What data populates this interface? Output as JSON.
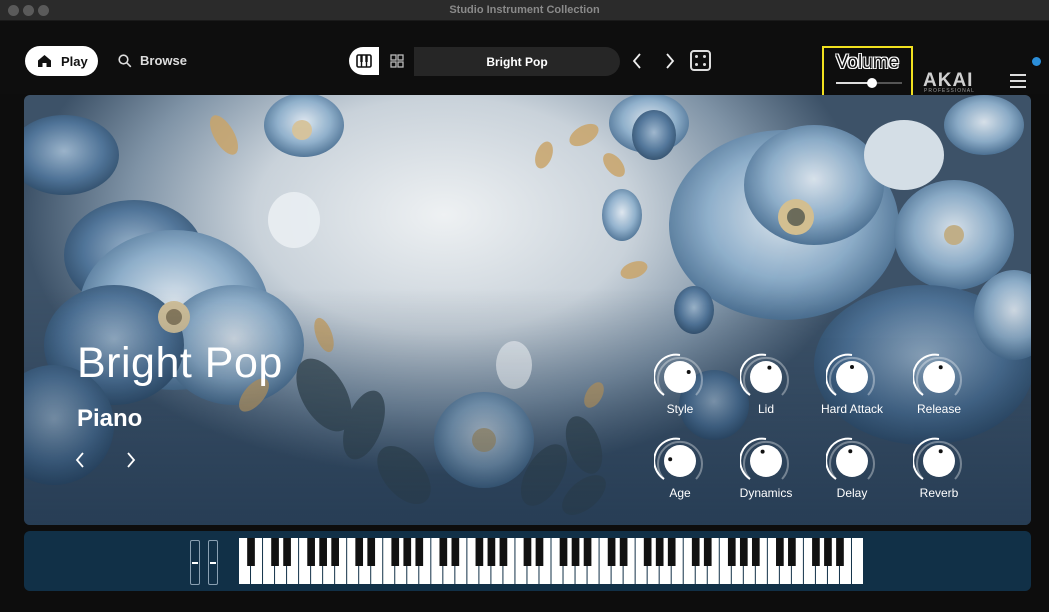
{
  "window": {
    "title": "Studio Instrument Collection"
  },
  "toolbar": {
    "play_label": "Play",
    "browse_label": "Browse",
    "preset_name": "Bright Pop",
    "volume_label": "Volume",
    "volume_level": 0.55,
    "brand": "AKAI",
    "brand_sub": "PROFESSIONAL"
  },
  "hero": {
    "preset_title": "Bright Pop",
    "instrument": "Piano"
  },
  "knobs": [
    {
      "label": "Style"
    },
    {
      "label": "Lid"
    },
    {
      "label": "Hard Attack"
    },
    {
      "label": "Release"
    },
    {
      "label": "Age"
    },
    {
      "label": "Dynamics"
    },
    {
      "label": "Delay"
    },
    {
      "label": "Reverb"
    }
  ],
  "colors": {
    "highlight": "#f1e11f",
    "panel": "#113047",
    "accent_dot": "#2b8ed9"
  }
}
